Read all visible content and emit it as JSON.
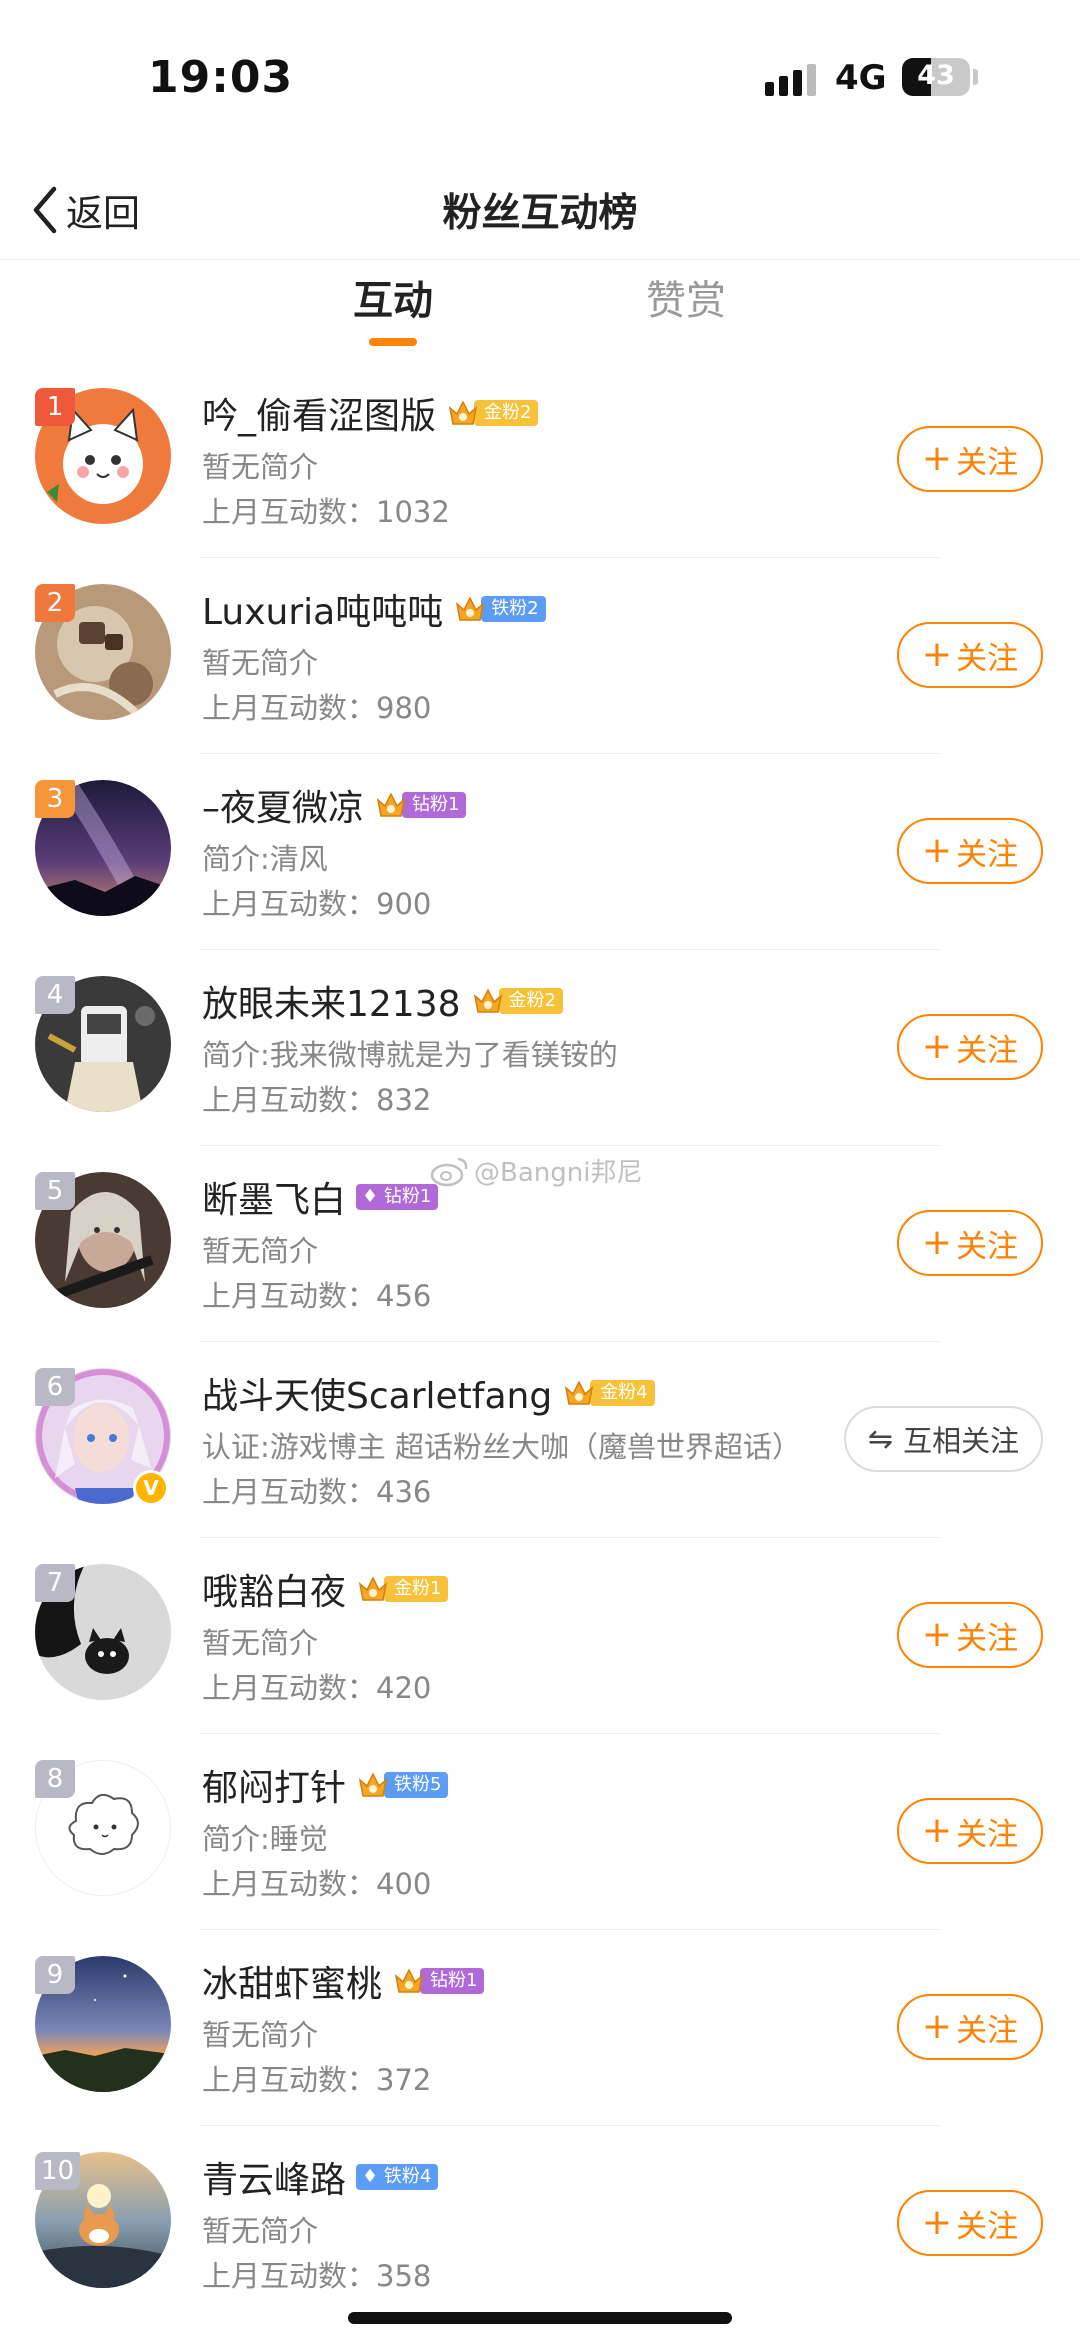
{
  "status_bar": {
    "time": "19:03",
    "network": "4G",
    "battery": "43"
  },
  "nav": {
    "back_label": "返回",
    "title": "粉丝互动榜"
  },
  "tabs": [
    {
      "label": "互动",
      "active": true
    },
    {
      "label": "赞赏",
      "active": false
    }
  ],
  "count_prefix": "上月互动数：",
  "watermark": "@Bangni邦尼",
  "follow_label": "关注",
  "mutual_label": "互相关注",
  "colors": {
    "accent": "#ff8200",
    "rank_top": "#f0583a",
    "rank_other": "#b9b9c6",
    "gold": "#f5a623",
    "iron": "#5b9df5",
    "diamond": "#b06ad8"
  },
  "rows": [
    {
      "rank": "1",
      "name": "吟_偷看涩图版",
      "badge": "金粉2",
      "badge_type": "gold",
      "intro": "暂无简介",
      "count": "1032",
      "button": "follow"
    },
    {
      "rank": "2",
      "name": "Luxuria吨吨吨",
      "badge": "铁粉2",
      "badge_type": "iron",
      "intro": "暂无简介",
      "count": "980",
      "button": "follow"
    },
    {
      "rank": "3",
      "name": "–夜夏微凉",
      "badge": "钻粉1",
      "badge_type": "diamond",
      "intro": "简介:清风",
      "count": "900",
      "button": "follow"
    },
    {
      "rank": "4",
      "name": "放眼未来12138",
      "badge": "金粉2",
      "badge_type": "gold",
      "intro": "简介:我来微博就是为了看镁铵的",
      "count": "832",
      "button": "follow"
    },
    {
      "rank": "5",
      "name": "断墨飞白",
      "badge": "钻粉1",
      "badge_type": "diamond",
      "intro": "暂无简介",
      "count": "456",
      "button": "follow"
    },
    {
      "rank": "6",
      "name": "战斗天使Scarletfang",
      "badge": "金粉4",
      "badge_type": "gold",
      "intro": "认证:游戏博主 超话粉丝大咖（魔兽世界超话）",
      "count": "436",
      "button": "mutual",
      "verified": "V"
    },
    {
      "rank": "7",
      "name": "哦豁白夜",
      "badge": "金粉1",
      "badge_type": "gold",
      "intro": "暂无简介",
      "count": "420",
      "button": "follow"
    },
    {
      "rank": "8",
      "name": "郁闷打针",
      "badge": "铁粉5",
      "badge_type": "iron",
      "intro": "简介:睡觉",
      "count": "400",
      "button": "follow"
    },
    {
      "rank": "9",
      "name": "冰甜虾蜜桃",
      "badge": "钻粉1",
      "badge_type": "diamond",
      "intro": "暂无简介",
      "count": "372",
      "button": "follow"
    },
    {
      "rank": "10",
      "name": "青云峰路",
      "badge": "铁粉4",
      "badge_type": "iron",
      "intro": "暂无简介",
      "count": "358",
      "button": "follow"
    }
  ]
}
